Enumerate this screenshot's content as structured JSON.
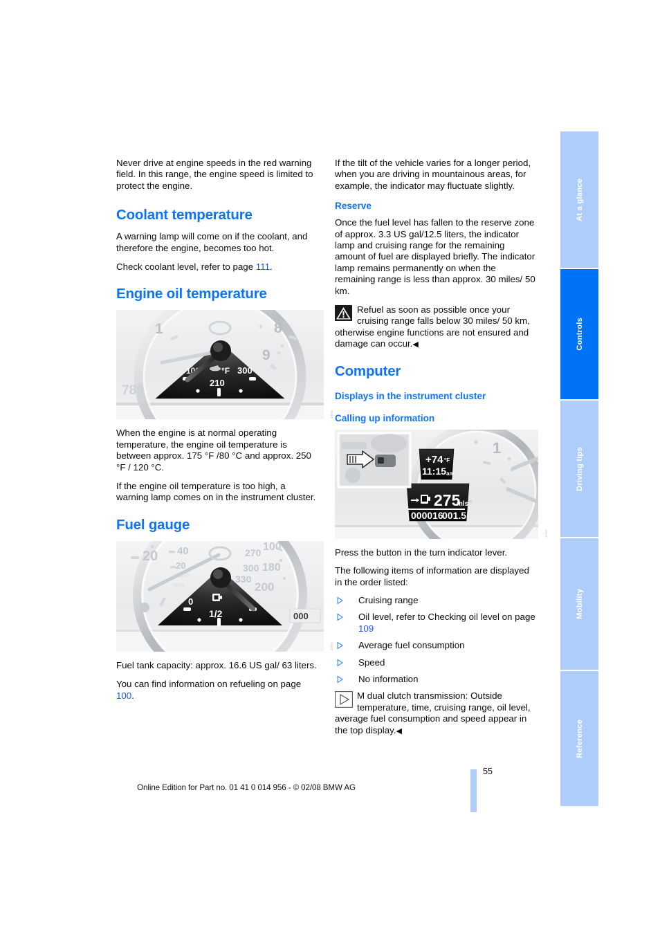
{
  "document": {
    "page_number": "55",
    "footer_text": "Online Edition for Part no. 01 41 0 014 956 - © 02/08 BMW AG"
  },
  "left_column": {
    "intro_paragraph": "Never drive at engine speeds in the red warning field. In this range, the engine speed is limited to protect the engine.",
    "coolant": {
      "heading": "Coolant temperature",
      "paragraph": "A warning lamp will come on if the coolant, and therefore the engine, becomes too hot.",
      "refer_prefix": "Check coolant level, refer to page ",
      "refer_page": "111",
      "refer_suffix": "."
    },
    "engine_oil": {
      "heading": "Engine oil temperature",
      "figure": {
        "name": "engine-oil-temperature-gauge",
        "dial_unit": "°F",
        "dial_max": "300",
        "dial_mid": "210",
        "dial_min": "100",
        "tach_marks": [
          "1",
          "8",
          "9",
          "789"
        ]
      },
      "paragraph_1": "When the engine is at normal operating temperature, the engine oil temperature is between approx. 175 °F /80 °C and approx. 250 °F / 120 °C.",
      "paragraph_2": "If the engine oil temperature is too high, a warning lamp comes on in the instrument cluster."
    },
    "fuel_gauge": {
      "heading": "Fuel gauge",
      "figure": {
        "name": "fuel-gauge",
        "fuel_marks": [
          "0",
          "1/2"
        ],
        "speed_marks": [
          "20",
          "40",
          "20",
          "270",
          "300",
          "330",
          "100",
          "180",
          "200"
        ],
        "odometer": "000"
      },
      "paragraph_1": "Fuel tank capacity: approx. 16.6 US gal/ 63 liters.",
      "refer_prefix": "You can find information on refueling on page ",
      "refer_page": "100",
      "refer_suffix": "."
    }
  },
  "right_column": {
    "tilt_paragraph": "If the tilt of the vehicle varies for a longer period, when you are driving in mountainous areas, for example, the indicator may fluctuate slightly.",
    "reserve": {
      "heading": "Reserve",
      "paragraph": "Once the fuel level has fallen to the reserve zone of approx. 3.3 US gal/12.5 liters, the indicator lamp and cruising range for the remaining amount of fuel are displayed briefly. The indicator lamp remains permanently on when the remaining range is less than approx. 30 miles/ 50 km.",
      "warning": "Refuel as soon as possible once your cruising range falls below 30 miles/ 50 km, otherwise engine functions are not ensured and damage can occur.",
      "warning_endmark": "◀"
    },
    "computer": {
      "heading": "Computer",
      "subheading": "Displays in the instrument cluster",
      "subsubheading": "Calling up information",
      "figure": {
        "name": "instrument-cluster-computer-display",
        "outside_temperature": "+74",
        "temperature_unit": "°F",
        "clock": "11:15",
        "clock_meridiem": "am",
        "range_value": "275",
        "range_unit": "mls",
        "odometer_total": "000016",
        "odometer_trip": "001.5",
        "tach_mark": "1"
      },
      "instruction": "Press the button in the turn indicator lever.",
      "list_intro": "The following items of information are displayed in the order listed:",
      "items": [
        {
          "text": "Cruising range"
        },
        {
          "text": "Oil level, refer to Checking oil level on page ",
          "link": "109",
          "suffix": ""
        },
        {
          "text": "Average fuel consumption"
        },
        {
          "text": "Speed"
        },
        {
          "text": "No information"
        }
      ],
      "note_title": "M dual clutch transmission:",
      "note_body": "Outside temperature, time, cruising range, oil level, average fuel consumption and speed appear in the top display.",
      "note_endmark": "◀"
    }
  },
  "tabs": [
    {
      "label": "At a glance",
      "active": false
    },
    {
      "label": "Controls",
      "active": true
    },
    {
      "label": "Driving tips",
      "active": false
    },
    {
      "label": "Mobility",
      "active": false
    },
    {
      "label": "Reference",
      "active": false
    }
  ],
  "colors": {
    "heading_blue": "#0d74f5",
    "link_blue": "#1a56e8",
    "tab_active": "#0072f5",
    "tab_inactive": "#aecdfb"
  }
}
